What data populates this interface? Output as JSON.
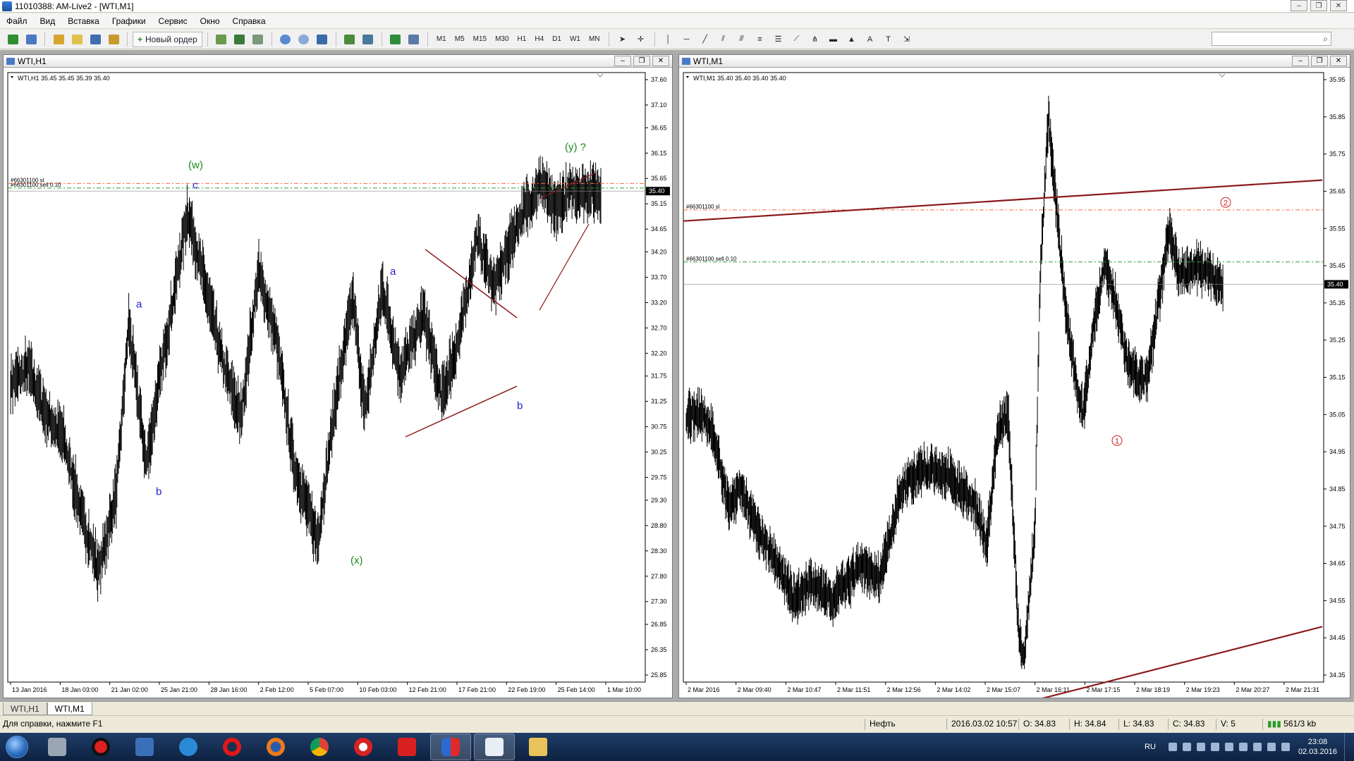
{
  "app": {
    "title": "11010388: AM-Live2 - [WTI,M1]"
  },
  "menu": [
    "Файл",
    "Вид",
    "Вставка",
    "Графики",
    "Сервис",
    "Окно",
    "Справка"
  ],
  "toolbar": {
    "new_order_label": "Новый ордер",
    "timeframes": [
      "M1",
      "M5",
      "M15",
      "M30",
      "H1",
      "H4",
      "D1",
      "W1",
      "MN"
    ]
  },
  "charts": {
    "left": {
      "window_title": "WTI,H1",
      "header": "WTI,H1  35.45 35.45 35.39 35.40",
      "price_labels": [
        "37.60",
        "37.10",
        "36.65",
        "36.15",
        "35.65",
        "35.15",
        "34.65",
        "34.20",
        "33.70",
        "33.20",
        "32.70",
        "32.20",
        "31.75",
        "31.25",
        "30.75",
        "30.25",
        "29.75",
        "29.30",
        "28.80",
        "28.30",
        "27.80",
        "27.30",
        "26.85",
        "26.35",
        "25.85"
      ],
      "price_range": [
        25.85,
        37.6
      ],
      "current_price": "35.40",
      "time_labels": [
        "13 Jan 2016",
        "18 Jan 03:00",
        "21 Jan 02:00",
        "25 Jan 21:00",
        "28 Jan 16:00",
        "2 Feb 12:00",
        "5 Feb 07:00",
        "10 Feb 03:00",
        "12 Feb 21:00",
        "17 Feb 21:00",
        "22 Feb 19:00",
        "25 Feb 14:00",
        "1 Mar 10:00"
      ],
      "order_lines": {
        "sl_label": "#66301100 sl",
        "sl_price": 35.55,
        "sell_label": "#66301100 sell 0.10",
        "sell_price": 35.46
      },
      "wave_labels": [
        {
          "text": "a",
          "color": "#1f1fc8"
        },
        {
          "text": "b",
          "color": "#1f1fc8"
        },
        {
          "text": "(w)",
          "color": "#1a8a1a"
        },
        {
          "text": "c",
          "color": "#1f1fc8"
        },
        {
          "text": "(x)",
          "color": "#1a8a1a"
        },
        {
          "text": "a",
          "color": "#1f1fc8"
        },
        {
          "text": "b",
          "color": "#1f1fc8"
        },
        {
          "text": "(y) ?",
          "color": "#1a8a1a"
        }
      ]
    },
    "right": {
      "window_title": "WTI,M1",
      "header": "WTI,M1  35.40 35.40 35.40 35.40",
      "price_labels": [
        "35.95",
        "35.85",
        "35.75",
        "35.65",
        "35.55",
        "35.45",
        "35.35",
        "35.25",
        "35.15",
        "35.05",
        "34.95",
        "34.85",
        "34.75",
        "34.65",
        "34.55",
        "34.45",
        "34.35"
      ],
      "price_range": [
        34.35,
        35.95
      ],
      "current_price": "35.40",
      "time_labels": [
        "2 Mar 2016",
        "2 Mar 09:40",
        "2 Mar 10:47",
        "2 Mar 11:51",
        "2 Mar 12:56",
        "2 Mar 14:02",
        "2 Mar 15:07",
        "2 Mar 16:11",
        "2 Mar 17:15",
        "2 Mar 18:19",
        "2 Mar 19:23",
        "2 Mar 20:27",
        "2 Mar 21:31"
      ],
      "order_lines": {
        "sl_label": "#66301100 sl",
        "sl_price": 35.6,
        "sell_label": "#66301100 sell 0.10",
        "sell_price": 35.46
      },
      "wave_labels": [
        {
          "text": "1",
          "color": "#d02020"
        },
        {
          "text": "2",
          "color": "#d02020"
        }
      ]
    }
  },
  "tabs": [
    "WTI,H1",
    "WTI,M1"
  ],
  "status": {
    "help": "Для справки, нажмите F1",
    "profile": "Нефть",
    "datetime": "2016.03.02 10:57",
    "open": "O: 34.83",
    "high": "H: 34.84",
    "low": "L: 34.83",
    "close": "C: 34.83",
    "volume": "V: 5",
    "traffic": "561/3 kb"
  },
  "taskbar": {
    "lang": "RU",
    "time": "23:08",
    "date": "02.03.2016",
    "apps": [
      "windows-explorer",
      "recorder",
      "remote-desktop",
      "internet-explorer",
      "opera",
      "firefox",
      "chrome",
      "yandex-browser",
      "ig",
      "metatrader",
      "tick-app",
      "file-manager"
    ]
  },
  "colors": {
    "candle": "#000000",
    "sl_line": "#ff6a3d",
    "sell_line": "#2aa02a",
    "trend_line": "#8b1a1a",
    "price_tag_bg": "#000000"
  }
}
